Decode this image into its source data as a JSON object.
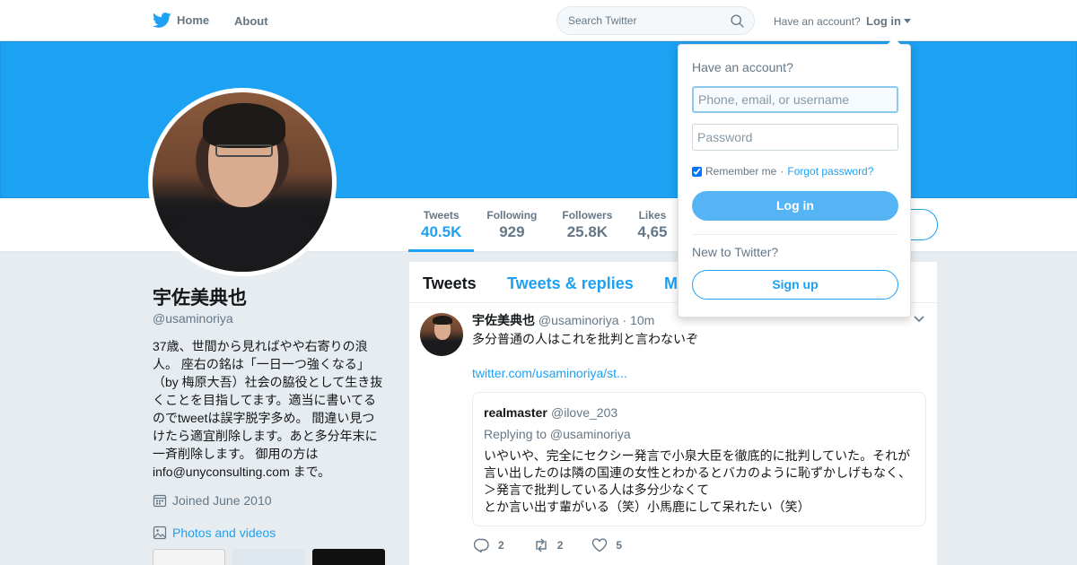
{
  "nav": {
    "home_label": "Home",
    "about_label": "About",
    "search_placeholder": "Search Twitter",
    "have_account": "Have an account?",
    "login_label": "Log in"
  },
  "profile": {
    "name": "宇佐美典也",
    "handle": "@usaminoriya",
    "bio_lines": [
      "37歳、世間から見ればやや右寄りの浪",
      "人。 座右の銘は「一日一つ強くなる」",
      "（by 梅原大吾）社会の脇役として生き抜",
      "くことを目指してます。適当に書いてる",
      "のでtweetは誤字脱字多め。 間違い見つ",
      "けたら適宜削除します。あと多分年末に",
      "一斉削除します。 御用の方は",
      "info@unyconsulting.com まで。"
    ],
    "joined": "Joined June 2010",
    "photos_label": "Photos and videos"
  },
  "stats": [
    {
      "label": "Tweets",
      "value": "40.5K"
    },
    {
      "label": "Following",
      "value": "929"
    },
    {
      "label": "Followers",
      "value": "25.8K"
    },
    {
      "label": "Likes",
      "value": "4,65"
    }
  ],
  "tabs": [
    "Tweets",
    "Tweets & replies",
    "M"
  ],
  "tweet": {
    "name": "宇佐美典也",
    "handle": "@usaminoriya",
    "dot": "·",
    "time": "10m",
    "text": "多分普通の人はこれを批判と言わないぞ",
    "link": "twitter.com/usaminoriya/st...",
    "quote": {
      "name": "realmaster",
      "handle": "@ilove_203",
      "replying": "Replying to @usaminoriya",
      "body_lines": [
        "いやいや、完全にセクシー発言で小泉大臣を徹底的に批判していた。それが",
        "言い出したのは隣の国連の女性とわかるとバカのように恥ずかしげもなく、",
        "＞発言で批判している人は多分少なくて",
        "とか言い出す輩がいる（笑）小馬鹿にして呆れたい（笑）"
      ]
    },
    "actions": {
      "replies": "2",
      "retweets": "2",
      "likes": "5"
    }
  },
  "login_dropdown": {
    "title": "Have an account?",
    "username_placeholder": "Phone, email, or username",
    "password_placeholder": "Password",
    "remember": "Remember me",
    "dot": "·",
    "forgot": "Forgot password?",
    "login_button": "Log in",
    "new_to": "New to Twitter?",
    "signup_button": "Sign up"
  },
  "colors": {
    "brand_blue": "#1da1f2",
    "background": "#e6ecf0",
    "muted_text": "#657786"
  }
}
